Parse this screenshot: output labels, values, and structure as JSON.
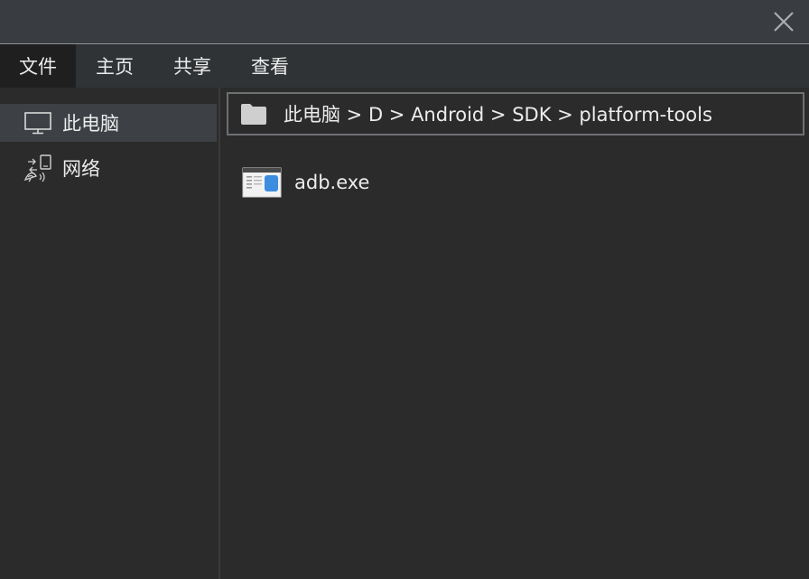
{
  "window": {
    "close_icon": "close-icon"
  },
  "menu": {
    "items": [
      {
        "label": "文件",
        "active": true
      },
      {
        "label": "主页",
        "active": false
      },
      {
        "label": "共享",
        "active": false
      },
      {
        "label": "查看",
        "active": false
      }
    ]
  },
  "sidebar": {
    "items": [
      {
        "label": "此电脑",
        "icon": "monitor-icon",
        "selected": true
      },
      {
        "label": "网络",
        "icon": "network-icon",
        "selected": false
      }
    ]
  },
  "address": {
    "icon": "folder-icon",
    "path": "此电脑 > D > Android > SDK > platform-tools"
  },
  "files": [
    {
      "name": "adb.exe",
      "icon": "exe-file-icon"
    }
  ],
  "colors": {
    "titlebar": "#393d41",
    "menubar": "#2f3336",
    "background": "#2b2b2b",
    "selected": "#3d4145",
    "accent": "#3c8de0"
  }
}
